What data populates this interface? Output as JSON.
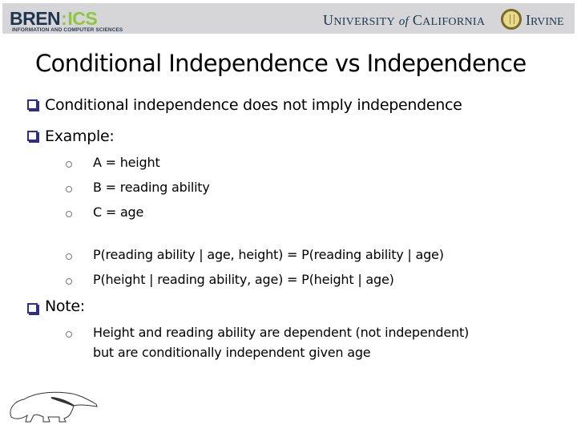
{
  "header": {
    "left_logo": {
      "part1": "BREN",
      "separator": ":",
      "part2": "ICS",
      "subtitle": "INFORMATION AND COMPUTER SCIENCES"
    },
    "right_logo": {
      "university_first": "U",
      "university_rest": "NIVERSITY",
      "of": "of",
      "california_first": "C",
      "california_rest": "ALIFORNIA",
      "irvine_first": "I",
      "irvine_rest": "RVINE"
    }
  },
  "slide": {
    "title": "Conditional Independence vs Independence",
    "bullets": [
      {
        "text": "Conditional independence does not imply independence"
      },
      {
        "text": "Example:"
      },
      {
        "text": "Note:"
      }
    ],
    "example_items": [
      "A = height",
      "B = reading ability",
      "C = age",
      "P(reading ability | age, height) = P(reading ability | age)",
      "P(height | reading ability, age) = P(height | age)"
    ],
    "note_items": [
      {
        "line1": "Height and reading ability are dependent (not independent)",
        "line2": "but are conditionally independent given age"
      }
    ]
  }
}
